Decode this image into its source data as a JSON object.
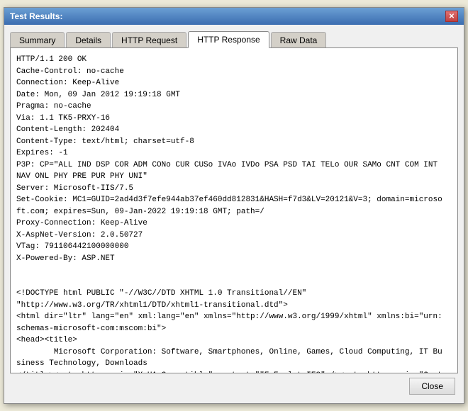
{
  "window": {
    "title": "Test Results:",
    "close_icon": "✕"
  },
  "tabs": [
    {
      "label": "Summary",
      "id": "summary",
      "active": false
    },
    {
      "label": "Details",
      "id": "details",
      "active": false
    },
    {
      "label": "HTTP Request",
      "id": "http-request",
      "active": false
    },
    {
      "label": "HTTP Response",
      "id": "http-response",
      "active": true
    },
    {
      "label": "Raw Data",
      "id": "raw-data",
      "active": false
    }
  ],
  "content": {
    "text": "HTTP/1.1 200 OK\nCache-Control: no-cache\nConnection: Keep-Alive\nDate: Mon, 09 Jan 2012 19:19:18 GMT\nPragma: no-cache\nVia: 1.1 TK5-PRXY-16\nContent-Length: 202404\nContent-Type: text/html; charset=utf-8\nExpires: -1\nP3P: CP=\"ALL IND DSP COR ADM CONo CUR CUSo IVAo IVDo PSA PSD TAI TELo OUR SAMo CNT COM INT NAV ONL PHY PRE PUR PHY UNI\"\nServer: Microsoft-IIS/7.5\nSet-Cookie: MC1=GUID=2ad4d3f7efe944ab37ef460dd812831&HASH=f7d3&LV=20121&V=3; domain=microsoft.com; expires=Sun, 09-Jan-2022 19:19:18 GMT; path=/\nProxy-Connection: Keep-Alive\nX-AspNet-Version: 2.0.50727\nVTag: 791106442100000000\nX-Powered-By: ASP.NET\n\n\n<!DOCTYPE html PUBLIC \"-//W3C//DTD XHTML 1.0 Transitional//EN\"\n\"http://www.w3.org/TR/xhtml1/DTD/xhtml1-transitional.dtd\">\n<html dir=\"ltr\" lang=\"en\" xml:lang=\"en\" xmlns=\"http://www.w3.org/1999/xhtml\" xmlns:bi=\"urn:schemas-microsoft-com:mscom:bi\">\n<head><title>\n        Microsoft Corporation: Software, Smartphones, Online, Games, Cloud Computing, IT Business Technology, Downloads\n</title><meta http-equiv=\"X-UA-Compatible\" content=\"IE=EmulateIE8\" /><meta http-equiv=\"Content-Type\" content=\"text/html; charset=utf-8\" />\n<script type=\"text/javascript\">\nvar QosInitTime = (new Date()).getTime();\nvar QosLoadTime = '';\nvar QosPageUri = encodeURI(window.location);"
  },
  "footer": {
    "close_label": "Close"
  }
}
